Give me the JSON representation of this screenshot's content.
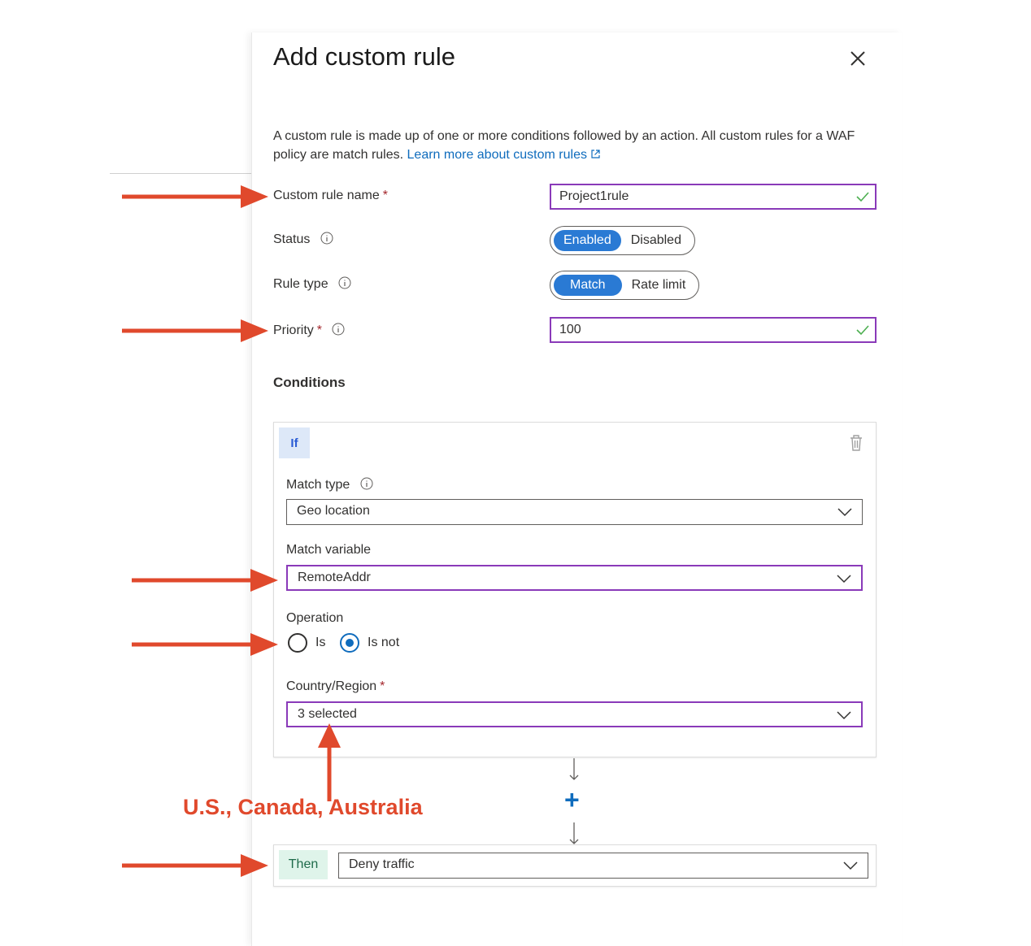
{
  "panel": {
    "title": "Add custom rule",
    "description": "A custom rule is made up of one or more conditions followed by an action. All custom rules for a WAF policy are match rules.",
    "learn_more_link": "Learn more about custom rules"
  },
  "form": {
    "custom_rule_name": {
      "label": "Custom rule name",
      "required_mark": "*",
      "value": "Project1rule"
    },
    "status": {
      "label": "Status",
      "options": [
        "Enabled",
        "Disabled"
      ],
      "selected": "Enabled"
    },
    "rule_type": {
      "label": "Rule type",
      "options": [
        "Match",
        "Rate limit"
      ],
      "selected": "Match"
    },
    "priority": {
      "label": "Priority",
      "required_mark": "*",
      "value": "100"
    }
  },
  "conditions": {
    "heading": "Conditions",
    "if_label": "If",
    "match_type": {
      "label": "Match type",
      "value": "Geo location"
    },
    "match_variable": {
      "label": "Match variable",
      "value": "RemoteAddr"
    },
    "operation": {
      "label": "Operation",
      "options": [
        "Is",
        "Is not"
      ],
      "selected": "Is not"
    },
    "country_region": {
      "label": "Country/Region",
      "required_mark": "*",
      "value": "3 selected"
    }
  },
  "action": {
    "then_label": "Then",
    "value": "Deny traffic"
  },
  "annotation": {
    "text": "U.S., Canada, Australia"
  },
  "colors": {
    "annotation_red": "#e0492c",
    "accent_blue": "#2a7ad4",
    "highlight_purple": "#8a3ab9"
  },
  "icons": [
    "close-icon",
    "external-link-icon",
    "info-icon",
    "checkmark-icon",
    "trash-icon",
    "chevron-down-icon",
    "plus-icon",
    "arrow-down-icon",
    "annotation-arrow"
  ]
}
